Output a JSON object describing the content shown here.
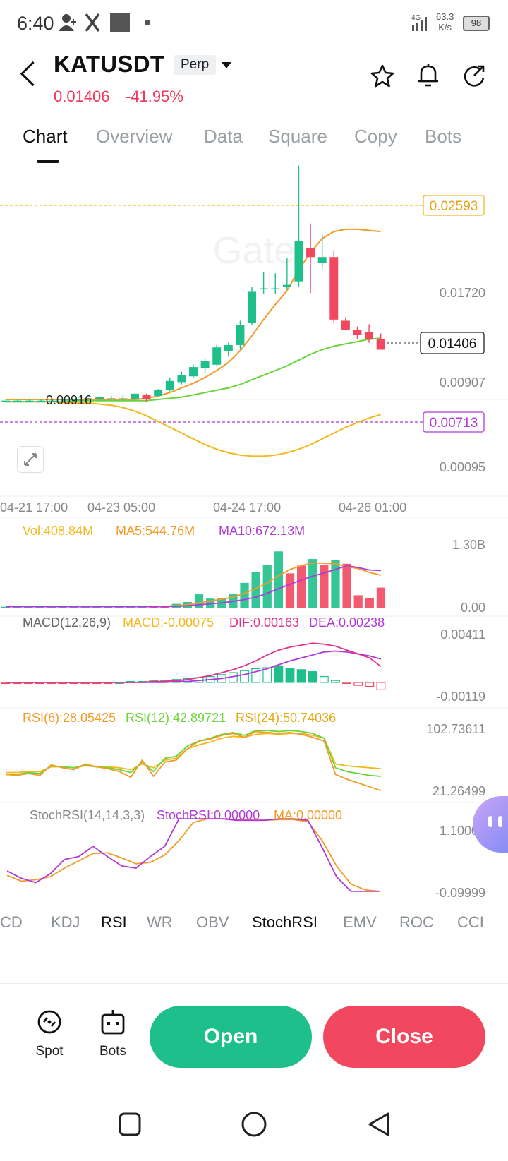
{
  "status_bar": {
    "time": "6:40",
    "network_speed_value": "63.3",
    "network_speed_unit": "K/s",
    "network_type": "4G",
    "battery": "98"
  },
  "header": {
    "symbol": "KATUSDT",
    "contract_type": "Perp",
    "last_price": "0.01406",
    "change_pct": "-41.95%",
    "icons": [
      "back-arrow-icon",
      "star-icon",
      "bell-icon",
      "share-icon"
    ]
  },
  "tabs": [
    "Chart",
    "Overview",
    "Data",
    "Square",
    "Copy",
    "Bots"
  ],
  "active_tab": "Chart",
  "colors": {
    "up": "#1fbf8b",
    "down": "#f2485f",
    "ma_orange": "#f29b26",
    "ma_green": "#6ad43a",
    "yellow": "#f3b81d",
    "purple": "#b03ad6",
    "pink": "#e2338a"
  },
  "chart_data": [
    {
      "type": "candlestick",
      "title": "",
      "price_labels": [
        "0.02593",
        "0.01720",
        "0.01406",
        "0.00907",
        "0.00713",
        "0.00095"
      ],
      "last_price_tag": "0.01406",
      "high_marker": "0.02593",
      "low_marker": "0.00916",
      "purple_marker": "0.00713",
      "x_ticks": [
        "04-21 17:00",
        "04-23 05:00",
        "04-24 17:00",
        "04-26 01:00"
      ],
      "ylim": [
        0.00095,
        0.0296
      ],
      "candles": [
        {
          "o": 0.0092,
          "h": 0.0093,
          "l": 0.0091,
          "c": 0.0092
        },
        {
          "o": 0.0092,
          "h": 0.0093,
          "l": 0.0091,
          "c": 0.0092
        },
        {
          "o": 0.0092,
          "h": 0.0093,
          "l": 0.0091,
          "c": 0.0092
        },
        {
          "o": 0.0092,
          "h": 0.0093,
          "l": 0.0091,
          "c": 0.0092
        },
        {
          "o": 0.0092,
          "h": 0.0093,
          "l": 0.0091,
          "c": 0.0092
        },
        {
          "o": 0.0092,
          "h": 0.0093,
          "l": 0.0091,
          "c": 0.0093
        },
        {
          "o": 0.0093,
          "h": 0.0094,
          "l": 0.0092,
          "c": 0.0093
        },
        {
          "o": 0.0093,
          "h": 0.0094,
          "l": 0.0092,
          "c": 0.0094
        },
        {
          "o": 0.0093,
          "h": 0.0095,
          "l": 0.0092,
          "c": 0.0095
        },
        {
          "o": 0.0094,
          "h": 0.0096,
          "l": 0.0093,
          "c": 0.0094
        },
        {
          "o": 0.0094,
          "h": 0.0097,
          "l": 0.0092,
          "c": 0.0094
        },
        {
          "o": 0.0093,
          "h": 0.0098,
          "l": 0.0092,
          "c": 0.0098
        },
        {
          "o": 0.0097,
          "h": 0.0098,
          "l": 0.0091,
          "c": 0.0093
        },
        {
          "o": 0.0096,
          "h": 0.0102,
          "l": 0.0095,
          "c": 0.0101
        },
        {
          "o": 0.0101,
          "h": 0.0112,
          "l": 0.01,
          "c": 0.0109
        },
        {
          "o": 0.0108,
          "h": 0.0117,
          "l": 0.0106,
          "c": 0.0114
        },
        {
          "o": 0.0113,
          "h": 0.0123,
          "l": 0.0112,
          "c": 0.0121
        },
        {
          "o": 0.012,
          "h": 0.0128,
          "l": 0.0116,
          "c": 0.0126
        },
        {
          "o": 0.0123,
          "h": 0.014,
          "l": 0.0122,
          "c": 0.0138
        },
        {
          "o": 0.0135,
          "h": 0.0142,
          "l": 0.013,
          "c": 0.014
        },
        {
          "o": 0.014,
          "h": 0.0161,
          "l": 0.0136,
          "c": 0.0157
        },
        {
          "o": 0.0159,
          "h": 0.019,
          "l": 0.0157,
          "c": 0.0186
        },
        {
          "o": 0.0189,
          "h": 0.0203,
          "l": 0.0184,
          "c": 0.0189
        },
        {
          "o": 0.0189,
          "h": 0.0202,
          "l": 0.0184,
          "c": 0.0189
        },
        {
          "o": 0.019,
          "h": 0.0215,
          "l": 0.0188,
          "c": 0.0192
        },
        {
          "o": 0.0195,
          "h": 0.0295,
          "l": 0.019,
          "c": 0.023
        },
        {
          "o": 0.0224,
          "h": 0.0245,
          "l": 0.0185,
          "c": 0.0216
        },
        {
          "o": 0.0211,
          "h": 0.0236,
          "l": 0.0206,
          "c": 0.0216
        },
        {
          "o": 0.0216,
          "h": 0.0222,
          "l": 0.0159,
          "c": 0.0162
        },
        {
          "o": 0.0161,
          "h": 0.0164,
          "l": 0.0153,
          "c": 0.0153
        },
        {
          "o": 0.0153,
          "h": 0.0156,
          "l": 0.0145,
          "c": 0.0149
        },
        {
          "o": 0.0151,
          "h": 0.0158,
          "l": 0.0142,
          "c": 0.0145
        },
        {
          "o": 0.0145,
          "h": 0.015,
          "l": 0.0136,
          "c": 0.0136
        }
      ],
      "ma_fast": [
        0.0093,
        0.0093,
        0.0093,
        0.0093,
        0.0093,
        0.0093,
        0.0093,
        0.0093,
        0.0093,
        0.0093,
        0.0093,
        0.0093,
        0.0094,
        0.0096,
        0.0099,
        0.0103,
        0.0107,
        0.0112,
        0.0118,
        0.0125,
        0.0135,
        0.0148,
        0.0162,
        0.0175,
        0.0187,
        0.0205,
        0.022,
        0.0232,
        0.0238,
        0.024,
        0.024,
        0.0239,
        0.0238
      ],
      "ma_slow": [
        0.0091,
        0.0091,
        0.0091,
        0.0091,
        0.0091,
        0.0091,
        0.0092,
        0.0092,
        0.0092,
        0.0092,
        0.0092,
        0.0092,
        0.0092,
        0.0093,
        0.0094,
        0.0095,
        0.0097,
        0.0099,
        0.0101,
        0.0103,
        0.0106,
        0.011,
        0.0114,
        0.0118,
        0.0122,
        0.0127,
        0.0132,
        0.0136,
        0.0139,
        0.0141,
        0.0143,
        0.0145,
        0.0146
      ],
      "lower_band": [
        0.0091,
        0.0091,
        0.0091,
        0.0091,
        0.0091,
        0.009,
        0.009,
        0.009,
        0.0089,
        0.0088,
        0.0086,
        0.0083,
        0.0079,
        0.0074,
        0.0069,
        0.0064,
        0.0059,
        0.0054,
        0.005,
        0.0047,
        0.0045,
        0.0044,
        0.0044,
        0.0045,
        0.0047,
        0.005,
        0.0054,
        0.0059,
        0.0064,
        0.0069,
        0.0073,
        0.0077,
        0.008
      ]
    },
    {
      "type": "bar",
      "title": "",
      "labels": {
        "vol": "Vol:408.84M",
        "ma5": "MA5:544.76M",
        "ma10": "MA10:672.13M"
      },
      "y_ticks": [
        "1.30B",
        "0.00"
      ],
      "ylim": [
        0,
        1.45
      ],
      "values": [
        0.02,
        0.02,
        0.02,
        0.02,
        0.02,
        0.02,
        0.02,
        0.02,
        0.02,
        0.02,
        0.02,
        0.02,
        0.02,
        0.02,
        0.03,
        0.08,
        0.12,
        0.28,
        0.19,
        0.2,
        0.28,
        0.52,
        0.75,
        0.9,
        1.18,
        0.72,
        0.88,
        1.02,
        0.89,
        1.0,
        0.92,
        0.26,
        0.2,
        0.42
      ],
      "up": [
        true,
        true,
        true,
        true,
        true,
        true,
        true,
        true,
        true,
        true,
        true,
        true,
        true,
        false,
        false,
        true,
        true,
        true,
        true,
        true,
        true,
        true,
        true,
        true,
        true,
        false,
        false,
        true,
        false,
        true,
        false,
        false,
        false,
        false
      ],
      "ma5": [
        0.02,
        0.02,
        0.02,
        0.02,
        0.02,
        0.02,
        0.02,
        0.02,
        0.02,
        0.02,
        0.02,
        0.02,
        0.02,
        0.02,
        0.03,
        0.04,
        0.06,
        0.1,
        0.14,
        0.18,
        0.22,
        0.3,
        0.4,
        0.52,
        0.67,
        0.8,
        0.88,
        0.94,
        0.93,
        0.92,
        0.86,
        0.82,
        0.74,
        0.68
      ],
      "ma10": [
        0.02,
        0.02,
        0.02,
        0.02,
        0.02,
        0.02,
        0.02,
        0.02,
        0.02,
        0.02,
        0.02,
        0.02,
        0.02,
        0.02,
        0.02,
        0.03,
        0.04,
        0.06,
        0.08,
        0.1,
        0.13,
        0.17,
        0.22,
        0.3,
        0.4,
        0.49,
        0.58,
        0.66,
        0.73,
        0.8,
        0.88,
        0.84,
        0.79,
        0.78
      ]
    },
    {
      "type": "bar",
      "title": "",
      "labels": {
        "name": "MACD(12,26,9)",
        "macd": "MACD:-0.00075",
        "dif": "DIF:0.00163",
        "dea": "DEA:0.00238"
      },
      "y_ticks": [
        "0.00411",
        "-0.00119"
      ],
      "ylim": [
        -0.0013,
        0.0046
      ],
      "hist": [
        -0.0001,
        -0.0001,
        -0.0001,
        -0.0001,
        -0.0001,
        -0.0001,
        -0.0001,
        -0.0001,
        -0.0001,
        -0.0001,
        0.0,
        0.0001,
        0.0001,
        0.0002,
        0.0002,
        0.0003,
        0.0004,
        0.0005,
        0.0006,
        0.0008,
        0.001,
        0.0012,
        0.0014,
        0.0015,
        0.0017,
        0.0014,
        0.0013,
        0.0011,
        0.0006,
        0.0002,
        -0.0001,
        -0.0003,
        -0.0004,
        -0.00075
      ],
      "dif": [
        0.0,
        0.0,
        0.0,
        0.0,
        0.0,
        0.0,
        0.0,
        0.0,
        0.0,
        0.0,
        0.0,
        0.0,
        0.0,
        0.0001,
        0.0001,
        0.0002,
        0.0003,
        0.0005,
        0.0007,
        0.001,
        0.0013,
        0.0017,
        0.0022,
        0.0028,
        0.0033,
        0.0036,
        0.0038,
        0.004,
        0.0039,
        0.0037,
        0.0033,
        0.0029,
        0.0025,
        0.00163
      ],
      "dea": [
        0.0,
        0.0,
        0.0,
        0.0,
        0.0,
        0.0,
        0.0,
        0.0,
        0.0,
        0.0,
        0.0,
        0.0,
        0.0,
        0.0,
        0.0,
        0.0001,
        0.0001,
        0.0002,
        0.0003,
        0.0004,
        0.0006,
        0.0008,
        0.0011,
        0.0014,
        0.0018,
        0.0022,
        0.0025,
        0.0028,
        0.0031,
        0.0032,
        0.0031,
        0.0029,
        0.0027,
        0.00238
      ]
    },
    {
      "type": "line",
      "title": "",
      "labels": {
        "rsi6": "RSI(6):28.05425",
        "rsi12": "RSI(12):42.89721",
        "rsi24": "RSI(24):50.74036"
      },
      "y_ticks": [
        "102.73611",
        "21.26499"
      ],
      "ylim": [
        21.26499,
        102.73611
      ],
      "rsi6": [
        45,
        44,
        46,
        44,
        55,
        52,
        50,
        56,
        53,
        51,
        48,
        42,
        60,
        43,
        58,
        60,
        72,
        80,
        82,
        86,
        88,
        84,
        90,
        89,
        88,
        89,
        87,
        84,
        80,
        45,
        40,
        36,
        32,
        28
      ],
      "rsi12": [
        45,
        45,
        47,
        46,
        54,
        53,
        52,
        55,
        53,
        52,
        50,
        47,
        58,
        48,
        62,
        64,
        75,
        80,
        83,
        87,
        89,
        86,
        91,
        91,
        90,
        91,
        90,
        88,
        83,
        52,
        48,
        46,
        44,
        43
      ],
      "rsi24": [
        47,
        47,
        48,
        48,
        53,
        53,
        52,
        54,
        53,
        53,
        52,
        50,
        56,
        52,
        60,
        62,
        72,
        76,
        79,
        83,
        85,
        84,
        87,
        88,
        87,
        88,
        88,
        86,
        83,
        56,
        54,
        53,
        52,
        51
      ]
    },
    {
      "type": "line",
      "title": "",
      "labels": {
        "name": "StochRSI(14,14,3,3)",
        "stoch": "StochRSI:0.00000",
        "ma": "MA:0.00000"
      },
      "y_ticks": [
        "1.10000",
        "-0.09999"
      ],
      "ylim": [
        -0.09999,
        1.1
      ],
      "stoch": [
        0.28,
        0.18,
        0.12,
        0.24,
        0.44,
        0.48,
        0.62,
        0.48,
        0.35,
        0.32,
        0.48,
        0.62,
        1.0,
        1.0,
        1.0,
        1.0,
        0.98,
        0.98,
        0.98,
        1.0,
        1.0,
        0.98,
        0.6,
        0.2,
        0.0,
        0.0,
        0.0
      ],
      "ma": [
        0.22,
        0.14,
        0.16,
        0.2,
        0.32,
        0.42,
        0.52,
        0.53,
        0.46,
        0.38,
        0.4,
        0.5,
        0.7,
        0.95,
        1.0,
        1.0,
        0.99,
        0.98,
        0.98,
        0.99,
        0.99,
        0.96,
        0.7,
        0.35,
        0.1,
        0.02,
        0.0
      ]
    }
  ],
  "indicator_tabs": [
    "CD",
    "KDJ",
    "RSI",
    "WR",
    "OBV",
    "StochRSI",
    "EMV",
    "ROC",
    "CCI"
  ],
  "indicator_active": [
    "RSI",
    "StochRSI"
  ],
  "bottom": {
    "spot_label": "Spot",
    "bots_label": "Bots",
    "open_label": "Open",
    "close_label": "Close"
  }
}
